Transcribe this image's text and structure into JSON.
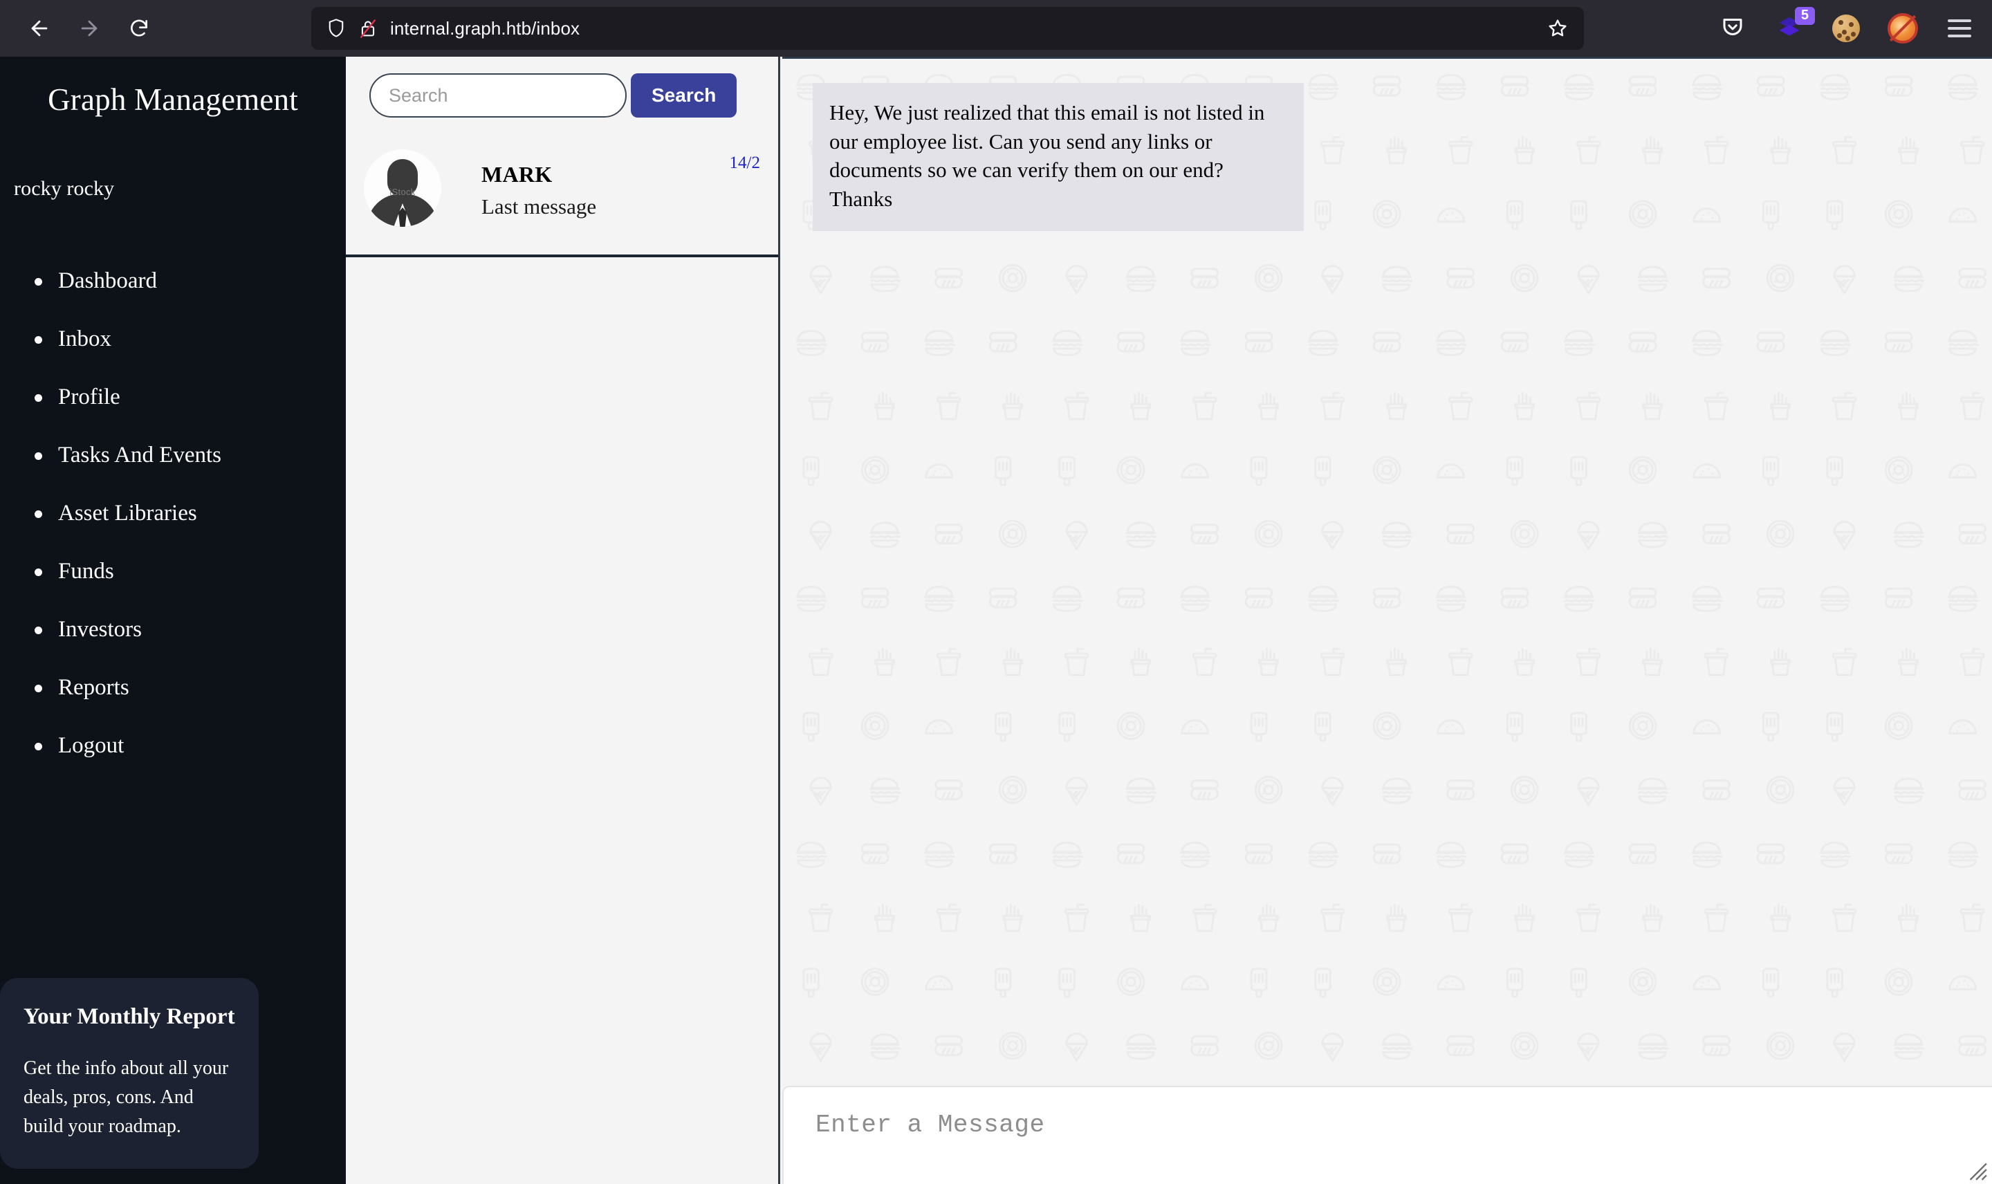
{
  "browser": {
    "back_icon": "back-arrow-icon",
    "forward_icon": "forward-arrow-icon",
    "reload_icon": "reload-icon",
    "shield_icon": "tracking-protection-shield-icon",
    "lock_icon": "insecure-connection-crossed-lock-icon",
    "url": "internal.graph.htb/inbox",
    "bookmark_icon": "star-bookmark-icon",
    "pocket_icon": "pocket-icon",
    "extension_icon": "layers-extension-icon",
    "extension_badge": "5",
    "cookie_icon": "cookie-icon",
    "fox_icon": "no-fox-icon",
    "menu_icon": "hamburger-menu-icon"
  },
  "sidebar": {
    "brand": "Graph Management",
    "username": "rocky rocky",
    "items": [
      {
        "label": "Dashboard"
      },
      {
        "label": "Inbox"
      },
      {
        "label": "Profile"
      },
      {
        "label": "Tasks And Events"
      },
      {
        "label": "Asset Libraries"
      },
      {
        "label": "Funds"
      },
      {
        "label": "Investors"
      },
      {
        "label": "Reports"
      },
      {
        "label": "Logout"
      }
    ],
    "report_card": {
      "title": "Your Monthly Report",
      "body": "Get the info about all your deals, pros, cons. And build your roadmap."
    }
  },
  "search": {
    "value": "",
    "placeholder": "Search",
    "button_label": "Search"
  },
  "conversations": [
    {
      "name": "MARK",
      "preview": "Last message",
      "date": "14/2",
      "avatar_watermark": "iStock"
    }
  ],
  "chat": {
    "messages": [
      {
        "from": "MARK",
        "text": "Hey, We just realized that this email is not listed in our employee list. Can you send any links or documents so we can verify them on our end? Thanks"
      }
    ],
    "composer_placeholder": "Enter a Message",
    "composer_value": ""
  },
  "colors": {
    "sidebar_bg": "#0d1219",
    "card_bg": "#1c2231",
    "panel_bg": "#f4f4f4",
    "accent_button": "#3a419a",
    "date_badge": "#1a25c4",
    "bubble_bg": "#e2e2e8",
    "divider": "#2e3a4a",
    "browser_chrome": "#2b2a33",
    "url_field": "#1c1b22"
  }
}
